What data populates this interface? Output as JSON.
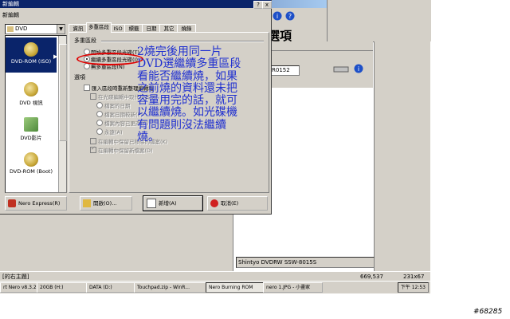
{
  "background": {
    "heading": "選項",
    "dropdown": "R0152",
    "drive_status": "Shintyo DVDRW SSW-8015S",
    "status_left": "[的右主題]",
    "status_coords": "669,537",
    "status_size": "231x67"
  },
  "taskbar": {
    "items": [
      "rt Nero v8.3.2...",
      "20GB (H:)",
      "DATA (D:)",
      "Touchpad.zip - WinR...",
      "Nero Burning ROM",
      "nero 1.JPG - 小畫家"
    ],
    "active_index": 4,
    "clock": "下午 12:53"
  },
  "dialog": {
    "title": "新編輯",
    "subtitle": "新編輯",
    "controls": [
      "?",
      "x"
    ],
    "combo_value": "DVD",
    "side_items": [
      "DVD-ROM (ISO)",
      "DVD 視訊",
      "DVD影片",
      "DVD-ROM (Boot)"
    ],
    "tabs": [
      "資訊",
      "多重區段",
      "ISO",
      "標籤",
      "日期",
      "其它",
      "燒錄"
    ],
    "active_tab": 1,
    "group_multisession": "多重區段",
    "radio_options": [
      "開始多重區段光碟(T)",
      "繼續多重區段光碟(I)",
      "無多重區段(N)"
    ],
    "radio_selected": 1,
    "group_options": "選項",
    "check_main": "匯入區段時重新整理編輯程",
    "check_sub": [
      "在光碟編輯中取代檔案(X)",
      "檔案的日期",
      "檔案日期較新(E)",
      "檔案內容已更改(C)",
      "永遠(A)",
      "在編輯中保留已移除的檔案(K)",
      "在編輯中保留新檔案(D)"
    ],
    "buttons": [
      "Nero Express(R)",
      "開啟(O)...",
      "新增(A)",
      "取消(E)"
    ]
  },
  "annotation": "2燒完後用同一片DVD選繼續多重區段看能否繼續燒，如果之前燒的資料還未把容量用完的話，就可以繼續燒。如光碟機有問題則沒法繼續燒。",
  "watermark": "#68285"
}
